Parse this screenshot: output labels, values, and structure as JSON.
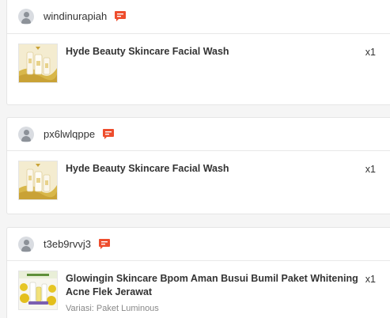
{
  "orders": [
    {
      "username": "windinurapiah",
      "product": {
        "name": "Hyde Beauty Skincare Facial Wash",
        "variation": "",
        "quantity": "x1",
        "image": "hyde-facial-wash"
      }
    },
    {
      "username": "px6lwlqppe",
      "product": {
        "name": "Hyde Beauty Skincare Facial Wash",
        "variation": "",
        "quantity": "x1",
        "image": "hyde-facial-wash"
      }
    },
    {
      "username": "t3eb9rvvj3",
      "product": {
        "name": "Glowingin Skincare Bpom Aman Busui Bumil Paket Whitening Acne Flek Jerawat",
        "variation": "Variasi: Paket Luminous",
        "quantity": "x1",
        "image": "glowingin-paket"
      }
    }
  ],
  "icons": {
    "avatar": "user-avatar-icon",
    "chat": "chat-icon"
  },
  "colors": {
    "chat_icon": "#ee4d2d",
    "avatar_bg": "#d9dce1",
    "thumb_gold": "#d8b74a"
  }
}
